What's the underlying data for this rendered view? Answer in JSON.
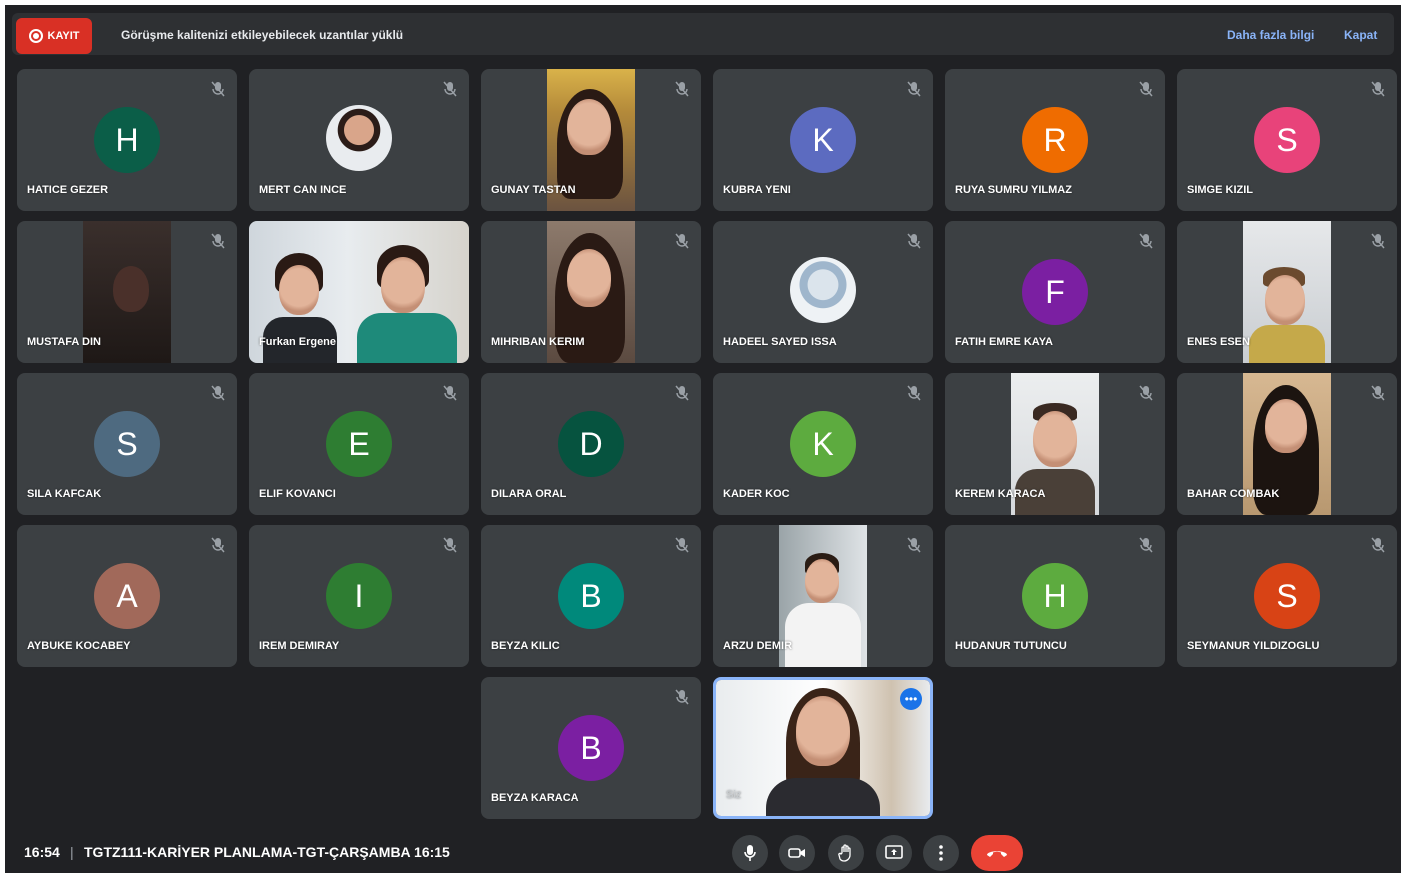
{
  "banner": {
    "record_label": "KAYIT",
    "notice": "Görüşme kalitenizi etkileyebilecek uzantılar yüklü",
    "learn_more": "Daha fazla bilgi",
    "close": "Kapat"
  },
  "participants": [
    {
      "name": "HATICE GEZER",
      "initial": "H",
      "color": "#0b5e48"
    },
    {
      "name": "MERT CAN INCE"
    },
    {
      "name": "GUNAY TASTAN"
    },
    {
      "name": "KUBRA YENI",
      "initial": "K",
      "color": "#5c6bc0"
    },
    {
      "name": "RUYA SUMRU YILMAZ",
      "initial": "R",
      "color": "#ef6c00"
    },
    {
      "name": "SIMGE KIZIL",
      "initial": "S",
      "color": "#e8437a"
    },
    {
      "name": "MUSTAFA DIN"
    },
    {
      "name": "Furkan Ergene"
    },
    {
      "name": "MIHRIBAN KERIM"
    },
    {
      "name": "HADEEL SAYED ISSA"
    },
    {
      "name": "FATIH EMRE KAYA",
      "initial": "F",
      "color": "#7b1fa2"
    },
    {
      "name": "ENES ESEN"
    },
    {
      "name": "SILA KAFCAK",
      "initial": "S",
      "color": "#4e6a80"
    },
    {
      "name": "ELIF KOVANCI",
      "initial": "E",
      "color": "#2e7d32"
    },
    {
      "name": "DILARA ORAL",
      "initial": "D",
      "color": "#06533f"
    },
    {
      "name": "KADER KOC",
      "initial": "K",
      "color": "#5dab3f"
    },
    {
      "name": "KEREM KARACA"
    },
    {
      "name": "BAHAR COMBAK"
    },
    {
      "name": "AYBUKE KOCABEY",
      "initial": "A",
      "color": "#a1695a"
    },
    {
      "name": "IREM DEMIRAY",
      "initial": "I",
      "color": "#2e7d32"
    },
    {
      "name": "BEYZA KILIC",
      "initial": "B",
      "color": "#00897b"
    },
    {
      "name": "ARZU DEMIR"
    },
    {
      "name": "HUDANUR TUTUNCU",
      "initial": "H",
      "color": "#5dab3f"
    },
    {
      "name": "SEYMANUR YILDIZOGLU",
      "initial": "S",
      "color": "#d84315"
    },
    {
      "name": "BEYZA KARACA",
      "initial": "B",
      "color": "#7b1fa2"
    },
    {
      "name": "Siz"
    }
  ],
  "footer": {
    "time": "16:54",
    "separator": "|",
    "meeting_title": "TGTZ111-KARİYER PLANLAMA-TGT-ÇARŞAMBA 16:15"
  },
  "icons": {
    "mic": "microphone-icon",
    "camera": "camera-icon",
    "hand": "raise-hand-icon",
    "present": "present-screen-icon",
    "more": "more-options-icon",
    "end": "end-call-icon"
  },
  "colors": {
    "background": "#202124",
    "tile": "#3c4043",
    "record": "#d93025",
    "link": "#8ab4f8",
    "end_call": "#ea4335"
  }
}
